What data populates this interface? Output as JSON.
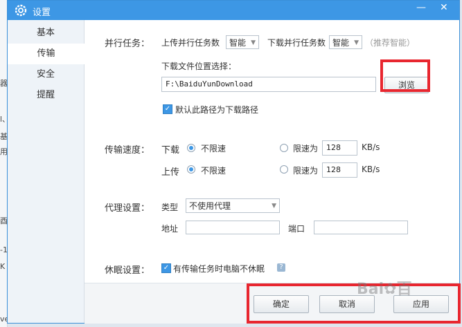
{
  "window": {
    "title": "设置",
    "min_label": "—",
    "close_label": "✕"
  },
  "background_fragments": [
    "器",
    "l、",
    "基",
    "用",
    "酉",
    "-1",
    "K",
    "ve"
  ],
  "sidebar": {
    "items": [
      {
        "label": "基本"
      },
      {
        "label": "传输",
        "active": true
      },
      {
        "label": "安全"
      },
      {
        "label": "提醒"
      }
    ]
  },
  "parallel": {
    "label": "并行任务：",
    "upload_label": "上传并行任务数",
    "upload_value": "智能",
    "download_label": "下载并行任务数",
    "download_value": "智能",
    "recommend": "（推荐智能）"
  },
  "location": {
    "label": "下载文件位置选择：",
    "path": "F:\\BaiduYunDownload",
    "browse": "浏览",
    "default_check": "默认此路径为下载路径"
  },
  "speed": {
    "label": "传输速度：",
    "download_label": "下载",
    "upload_label": "上传",
    "unlimited": "不限速",
    "limit": "限速为",
    "download_value": "128",
    "upload_value": "128",
    "unit": "KB/s"
  },
  "proxy": {
    "label": "代理设置：",
    "type_label": "类型",
    "type_value": "不使用代理",
    "addr_label": "地址",
    "port_label": "端口",
    "addr_value": "",
    "port_value": ""
  },
  "sleep": {
    "label": "休眠设置：",
    "check": "有传输任务时电脑不休眠",
    "help": "?"
  },
  "footer": {
    "ok": "确定",
    "cancel": "取消",
    "apply": "应用"
  },
  "watermark": "Bai✿百"
}
